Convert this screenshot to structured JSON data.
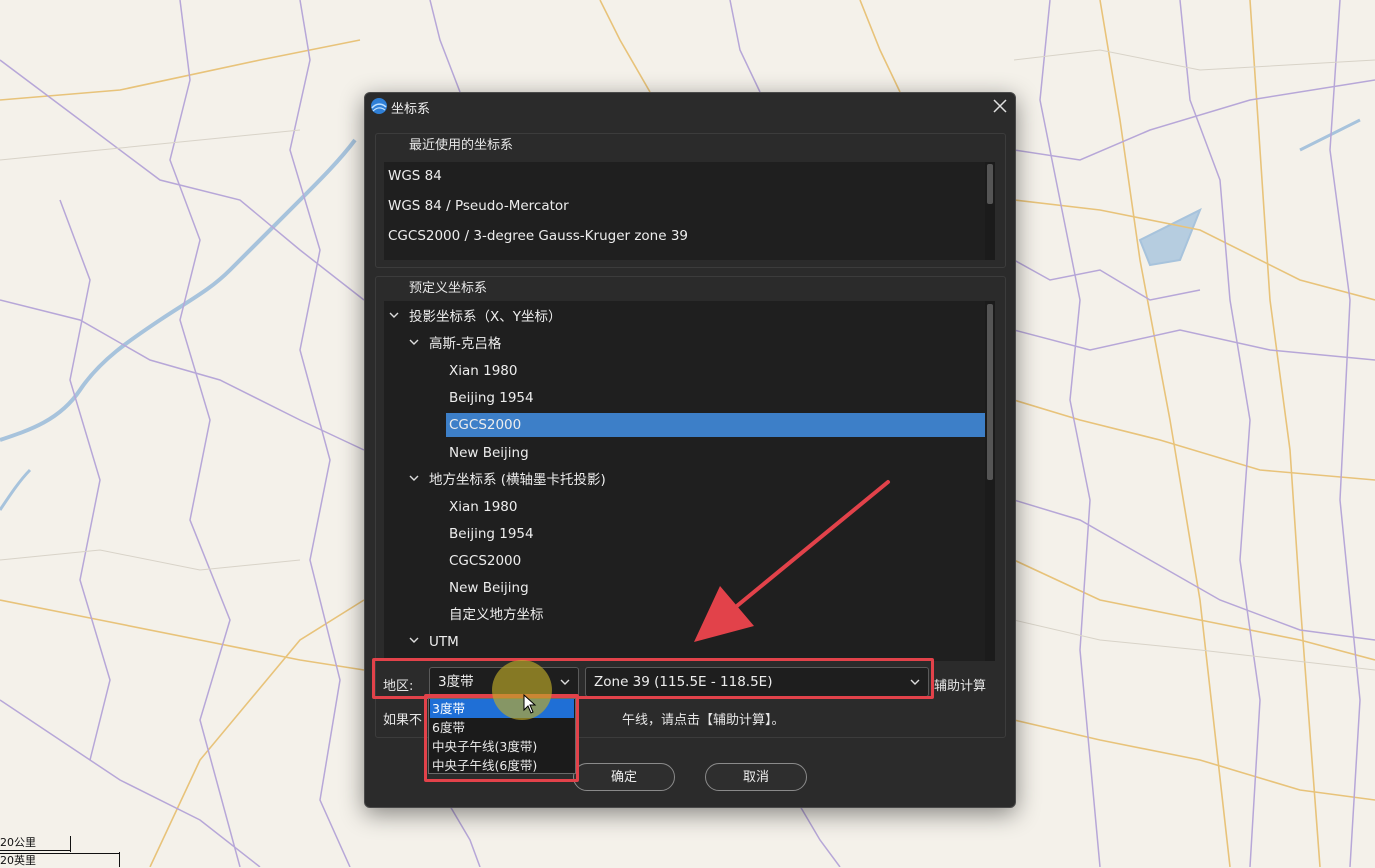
{
  "dialog": {
    "title": "坐标系",
    "recent_group_label": "最近使用的坐标系",
    "recent_items": [
      "WGS 84",
      "WGS 84 / Pseudo-Mercator",
      "CGCS2000 / 3-degree Gauss-Kruger zone 39"
    ],
    "predefined_group_label": "预定义坐标系",
    "tree": {
      "projected": "投影坐标系（X、Y坐标）",
      "gauss": "高斯-克吕格",
      "gauss_items": [
        "Xian 1980",
        "Beijing 1954",
        "CGCS2000",
        "New Beijing"
      ],
      "local": "地方坐标系 (横轴墨卡托投影)",
      "local_items": [
        "Xian 1980",
        "Beijing 1954",
        "CGCS2000",
        "New Beijing",
        "自定义地方坐标"
      ],
      "utm": "UTM"
    },
    "selected_item": "CGCS2000",
    "region_label": "地区:",
    "band_combo_value": "3度带",
    "zone_combo_value": "Zone 39 (115.5E - 118.5E)",
    "assist_label": "辅助计算",
    "hint_prefix": "如果不",
    "hint_suffix": "午线，请点击【辅助计算】。",
    "ok_label": "确定",
    "cancel_label": "取消"
  },
  "dropdown": {
    "options": [
      "3度带",
      "6度带",
      "中央子午线(3度带)",
      "中央子午线(6度带)"
    ],
    "active_index": 0
  },
  "scalebar": {
    "km_label": "20公里",
    "mi_label": "20英里"
  },
  "colors": {
    "selection": "#3d7fc8",
    "annotation_red": "#e2424a",
    "dropdown_active": "#1f6fd6"
  }
}
